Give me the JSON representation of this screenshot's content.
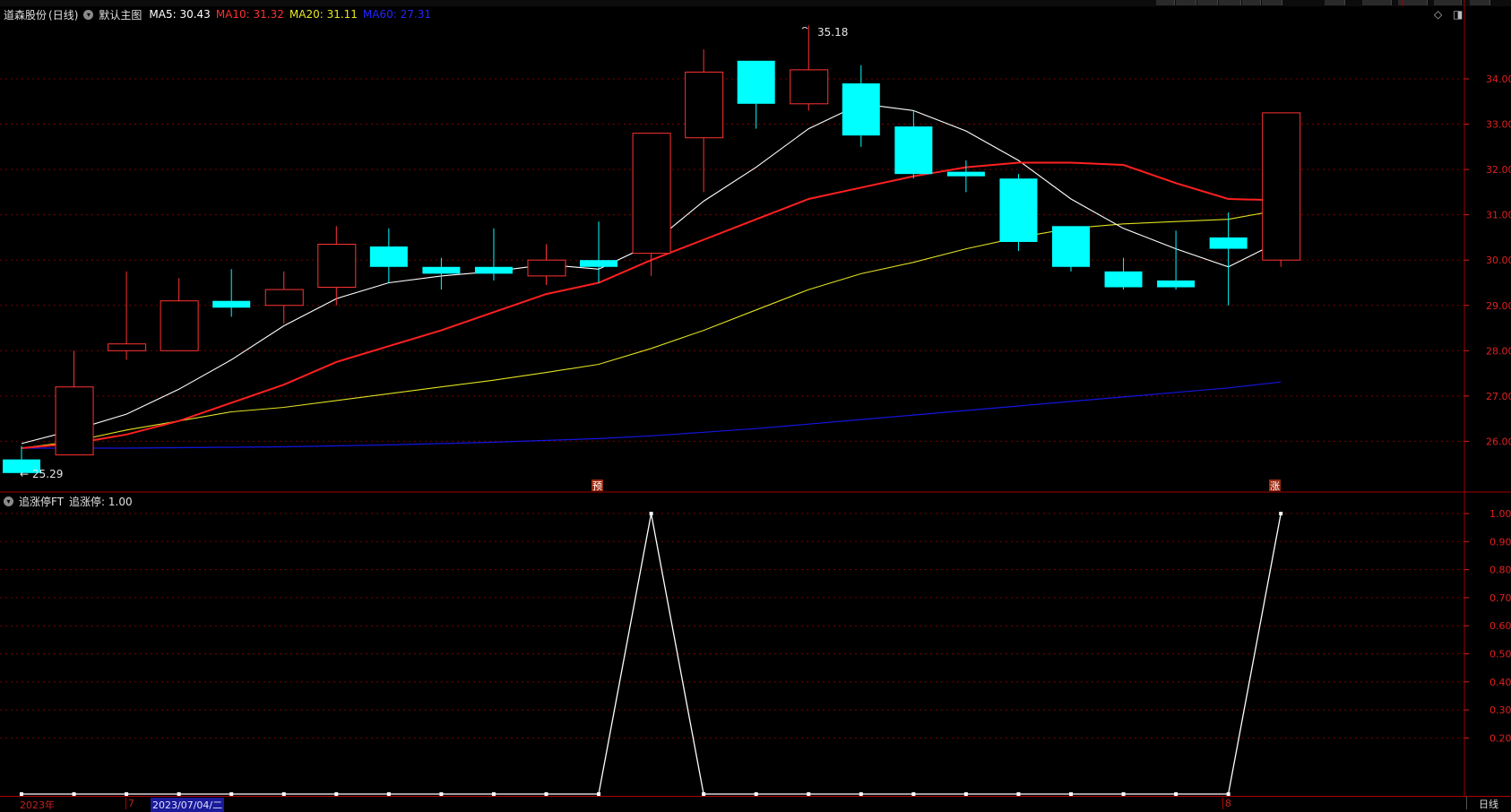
{
  "stock": {
    "name": "道森股份",
    "period": "(日线)",
    "main_chart": "默认主图",
    "ma5": "MA5: 30.43",
    "ma10": "MA10: 31.32",
    "ma20": "MA20: 31.11",
    "ma60": "MA60: 27.31"
  },
  "indicator": {
    "name": "追涨停FT",
    "value_text": "追涨停: 1.00"
  },
  "annotations": {
    "high_label": "35.18",
    "low_label": "25.29",
    "marker_yu": "预",
    "marker_zhang": "涨"
  },
  "bottom": {
    "year": "2023年",
    "month7": "7",
    "cursor_date": "2023/07/04/二",
    "month8": "8",
    "period_button": "日线"
  },
  "upper_axis": [
    "34.00",
    "33.00",
    "32.00",
    "31.00",
    "30.00",
    "29.00",
    "28.00",
    "27.00",
    "26.00"
  ],
  "lower_axis": [
    "1.00",
    "0.90",
    "0.80",
    "0.70",
    "0.60",
    "0.50",
    "0.40",
    "0.30",
    "0.20"
  ],
  "colors": {
    "up": "#ff3232",
    "down": "#00ffff",
    "ma5": "#ffffff",
    "ma10": "#ff2020",
    "ma20": "#e0e020",
    "ma60": "#1515e0",
    "axis": "#e02020",
    "grid": "#7a0000"
  },
  "chart_data": [
    {
      "type": "candlestick",
      "ylim": [
        25.0,
        35.5
      ],
      "candles": [
        {
          "o": 25.6,
          "c": 25.3,
          "h": 25.9,
          "l": 25.29
        },
        {
          "o": 25.7,
          "c": 27.2,
          "h": 28.0,
          "l": 25.7
        },
        {
          "o": 28.0,
          "c": 28.15,
          "h": 29.75,
          "l": 27.8
        },
        {
          "o": 28.0,
          "c": 29.1,
          "h": 29.6,
          "l": 28.0
        },
        {
          "o": 29.1,
          "c": 28.95,
          "h": 29.8,
          "l": 28.75
        },
        {
          "o": 29.0,
          "c": 29.35,
          "h": 29.75,
          "l": 28.6
        },
        {
          "o": 29.4,
          "c": 30.35,
          "h": 30.75,
          "l": 29.0
        },
        {
          "o": 30.3,
          "c": 29.85,
          "h": 30.7,
          "l": 29.5
        },
        {
          "o": 29.85,
          "c": 29.7,
          "h": 30.05,
          "l": 29.35
        },
        {
          "o": 29.85,
          "c": 29.7,
          "h": 30.7,
          "l": 29.55
        },
        {
          "o": 29.65,
          "c": 30.0,
          "h": 30.35,
          "l": 29.45
        },
        {
          "o": 30.0,
          "c": 29.85,
          "h": 30.85,
          "l": 29.5
        },
        {
          "o": 30.15,
          "c": 32.8,
          "h": 32.8,
          "l": 29.65
        },
        {
          "o": 32.7,
          "c": 34.15,
          "h": 34.65,
          "l": 31.5
        },
        {
          "o": 34.4,
          "c": 33.45,
          "h": 34.4,
          "l": 32.9
        },
        {
          "o": 33.45,
          "c": 34.2,
          "h": 35.18,
          "l": 33.3
        },
        {
          "o": 33.9,
          "c": 32.75,
          "h": 34.3,
          "l": 32.5
        },
        {
          "o": 32.95,
          "c": 31.9,
          "h": 33.3,
          "l": 31.8
        },
        {
          "o": 31.95,
          "c": 31.85,
          "h": 32.2,
          "l": 31.5
        },
        {
          "o": 31.8,
          "c": 30.4,
          "h": 31.9,
          "l": 30.2
        },
        {
          "o": 30.75,
          "c": 29.85,
          "h": 30.75,
          "l": 29.75
        },
        {
          "o": 29.75,
          "c": 29.4,
          "h": 30.05,
          "l": 29.35
        },
        {
          "o": 29.55,
          "c": 29.4,
          "h": 30.65,
          "l": 29.35
        },
        {
          "o": 30.5,
          "c": 30.25,
          "h": 31.05,
          "l": 29.0
        },
        {
          "o": 30.0,
          "c": 33.25,
          "h": 33.25,
          "l": 29.85
        }
      ],
      "ma5": [
        25.95,
        26.25,
        26.6,
        27.15,
        27.8,
        28.55,
        29.15,
        29.5,
        29.65,
        29.75,
        29.9,
        29.8,
        30.35,
        31.3,
        32.05,
        32.9,
        33.45,
        33.3,
        32.85,
        32.2,
        31.35,
        30.7,
        30.25,
        29.85,
        30.43
      ],
      "ma10": [
        25.85,
        25.95,
        26.15,
        26.45,
        26.85,
        27.25,
        27.75,
        28.1,
        28.45,
        28.85,
        29.25,
        29.5,
        30.0,
        30.45,
        30.9,
        31.35,
        31.6,
        31.85,
        32.05,
        32.15,
        32.15,
        32.1,
        31.7,
        31.35,
        31.32
      ],
      "ma20": [
        25.85,
        26.0,
        26.25,
        26.45,
        26.65,
        26.75,
        26.9,
        27.05,
        27.2,
        27.35,
        27.52,
        27.7,
        28.05,
        28.45,
        28.9,
        29.35,
        29.7,
        29.95,
        30.25,
        30.5,
        30.7,
        30.8,
        30.85,
        30.9,
        31.11
      ],
      "ma60": [
        25.85,
        25.85,
        25.85,
        25.86,
        25.87,
        25.88,
        25.9,
        25.92,
        25.95,
        25.98,
        26.02,
        26.06,
        26.12,
        26.2,
        26.28,
        26.38,
        26.48,
        26.58,
        26.68,
        26.78,
        26.88,
        26.98,
        27.08,
        27.18,
        27.31
      ]
    },
    {
      "type": "line",
      "series": [
        {
          "name": "追涨停",
          "values": [
            0,
            0,
            0,
            0,
            0,
            0,
            0,
            0,
            0,
            0,
            0,
            0,
            1,
            0,
            0,
            0,
            0,
            0,
            0,
            0,
            0,
            0,
            0,
            0,
            1
          ]
        }
      ],
      "ylim": [
        0,
        1.05
      ]
    }
  ]
}
